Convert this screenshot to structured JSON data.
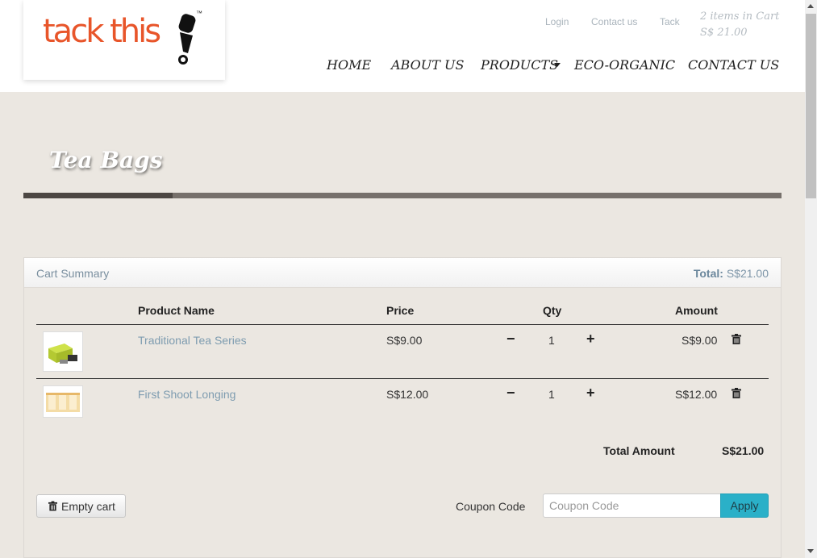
{
  "brand": {
    "logo_text": "tack this",
    "trademark": "™"
  },
  "top_links": {
    "login": "Login",
    "contact": "Contact us",
    "tack": "Tack"
  },
  "cart_info": {
    "items": "2 items in Cart",
    "total": "S$  21.00"
  },
  "nav": {
    "home": "HOME",
    "about": "ABOUT US",
    "products": "PRODUCTS",
    "eco": "ECO-ORGANIC",
    "contact": "CONTACT US"
  },
  "page": {
    "title": "Tea Bags"
  },
  "cart": {
    "header_title": "Cart Summary",
    "header_total_label": "Total:",
    "header_total_value": "S$21.00",
    "columns": {
      "product": "Product Name",
      "price": "Price",
      "qty": "Qty",
      "amount": "Amount"
    },
    "items": [
      {
        "name": "Traditional Tea Series",
        "price": "S$9.00",
        "qty": "1",
        "amount": "S$9.00"
      },
      {
        "name": "First Shoot Longing",
        "price": "S$12.00",
        "qty": "1",
        "amount": "S$12.00"
      }
    ],
    "total_label": "Total Amount",
    "total_value": "S$21.00",
    "empty_label": "Empty cart",
    "coupon_label": "Coupon Code",
    "coupon_placeholder": "Coupon Code",
    "apply_label": "Apply"
  },
  "colors": {
    "brand": "#e8552a",
    "accent": "#2ab0c8",
    "link": "#7e9cb0",
    "bar": "#76706b"
  },
  "icons": {
    "minus": "minus-icon",
    "plus": "plus-icon",
    "trash": "trash-icon",
    "caret": "caret-down-icon"
  }
}
